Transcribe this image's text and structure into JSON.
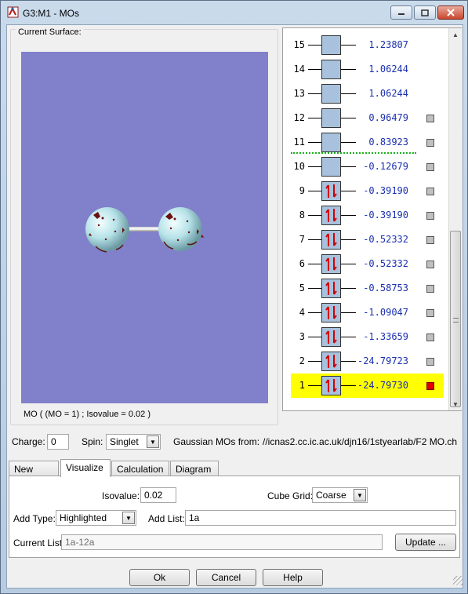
{
  "window": {
    "title": "G3:M1 - MOs",
    "icons": {
      "app": "gaussview-icon",
      "minimize": "minimize-icon",
      "maximize": "maximize-icon",
      "close": "close-icon"
    }
  },
  "surface": {
    "legend": "Current Surface:",
    "caption": "MO ( (MO = 1) ; Isovalue = 0.02 )",
    "background_color": "#8080cb"
  },
  "orbitals": [
    {
      "num": "15",
      "energy": "1.23807",
      "occupied": false,
      "checkbox": false,
      "highlighted": false
    },
    {
      "num": "14",
      "energy": "1.06244",
      "occupied": false,
      "checkbox": false,
      "highlighted": false
    },
    {
      "num": "13",
      "energy": "1.06244",
      "occupied": false,
      "checkbox": false,
      "highlighted": false
    },
    {
      "num": "12",
      "energy": "0.96479",
      "occupied": false,
      "checkbox": true,
      "highlighted": false
    },
    {
      "num": "11",
      "energy": "0.83923",
      "occupied": false,
      "checkbox": true,
      "highlighted": false
    },
    {
      "num": "10",
      "energy": "-0.12679",
      "occupied": false,
      "checkbox": true,
      "highlighted": false
    },
    {
      "num": "9",
      "energy": "-0.39190",
      "occupied": true,
      "checkbox": true,
      "highlighted": false
    },
    {
      "num": "8",
      "energy": "-0.39190",
      "occupied": true,
      "checkbox": true,
      "highlighted": false
    },
    {
      "num": "7",
      "energy": "-0.52332",
      "occupied": true,
      "checkbox": true,
      "highlighted": false
    },
    {
      "num": "6",
      "energy": "-0.52332",
      "occupied": true,
      "checkbox": true,
      "highlighted": false
    },
    {
      "num": "5",
      "energy": "-0.58753",
      "occupied": true,
      "checkbox": true,
      "highlighted": false
    },
    {
      "num": "4",
      "energy": "-1.09047",
      "occupied": true,
      "checkbox": true,
      "highlighted": false
    },
    {
      "num": "3",
      "energy": "-1.33659",
      "occupied": true,
      "checkbox": true,
      "highlighted": false
    },
    {
      "num": "2",
      "energy": "-24.79723",
      "occupied": true,
      "checkbox": true,
      "highlighted": false
    },
    {
      "num": "1",
      "energy": "-24.79730",
      "occupied": true,
      "checkbox": true,
      "highlighted": true
    }
  ],
  "colors": {
    "highlight": "#ffff00",
    "selected_check": "#e00000",
    "energy_text": "#1a2fb0",
    "homo_lumo_line": "#19b219",
    "electron_arrow": "#d40000"
  },
  "charge": {
    "label": "Charge:",
    "value": "0"
  },
  "spin": {
    "label": "Spin:",
    "value": "Singlet"
  },
  "source": {
    "label": "Gaussian MOs from:",
    "path": "//icnas2.cc.ic.ac.uk/djn16/1styearlab/F2 MO.ch"
  },
  "tabs": [
    {
      "label": "New MOs",
      "active": false
    },
    {
      "label": "Visualize",
      "active": true
    },
    {
      "label": "Calculation",
      "active": false
    },
    {
      "label": "Diagram",
      "active": false
    }
  ],
  "visualize": {
    "isovalue_label": "Isovalue:",
    "isovalue": "0.02",
    "cube_grid_label": "Cube Grid:",
    "cube_grid": "Coarse",
    "add_type_label": "Add Type:",
    "add_type": "Highlighted",
    "add_list_label": "Add List:",
    "add_list": "1a",
    "current_list_label": "Current List:",
    "current_list": "1a-12a",
    "update_label": "Update ..."
  },
  "buttons": {
    "ok": "Ok",
    "cancel": "Cancel",
    "help": "Help"
  }
}
